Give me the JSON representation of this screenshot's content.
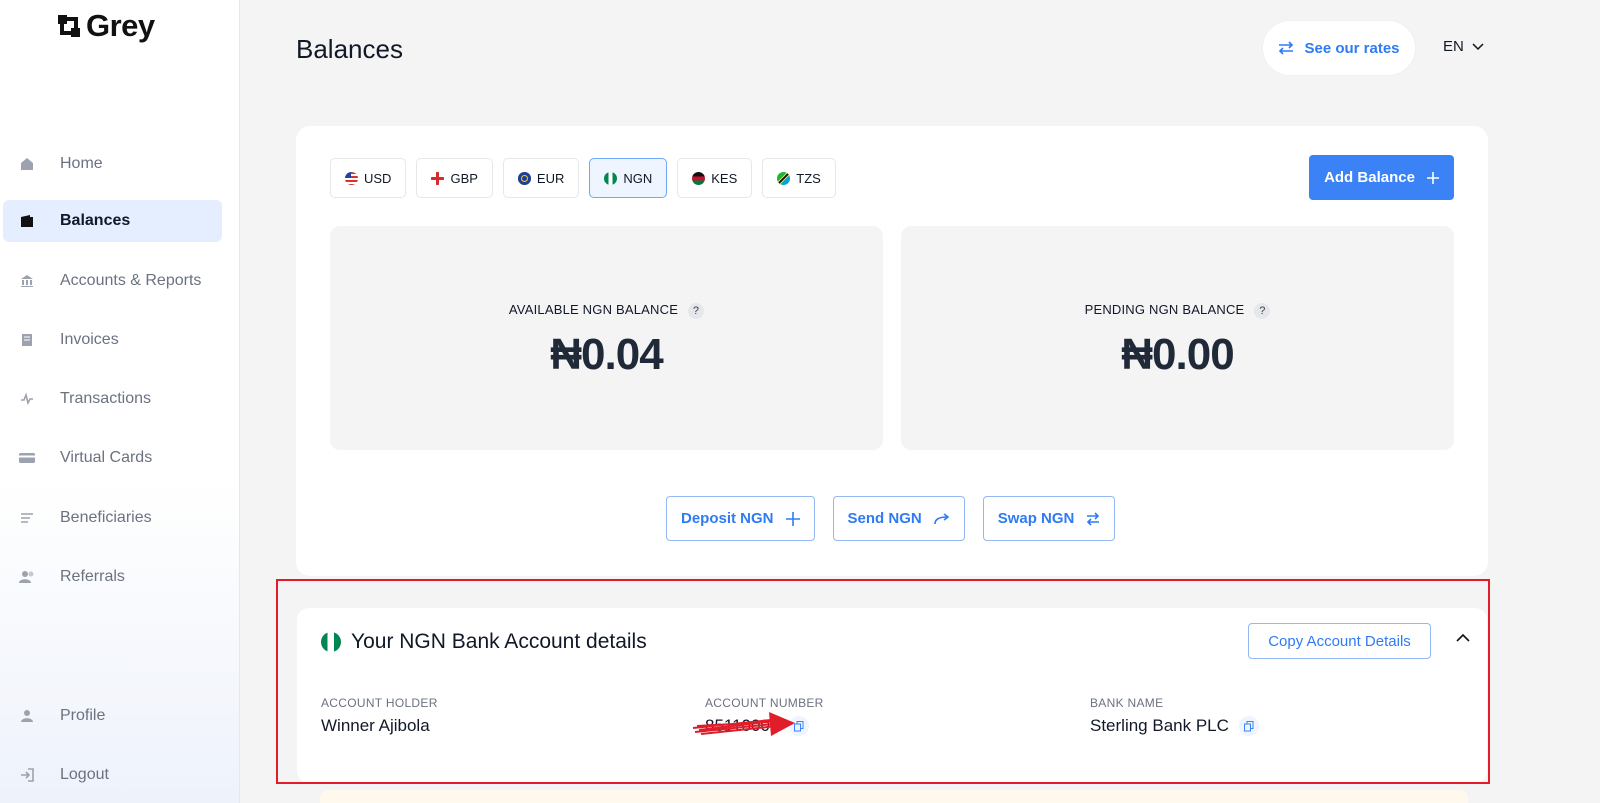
{
  "app": {
    "name": "Grey"
  },
  "sidebar": {
    "items": [
      {
        "label": "Home",
        "icon": "home-icon"
      },
      {
        "label": "Balances",
        "icon": "wallet-icon",
        "active": true
      },
      {
        "label": "Accounts & Reports",
        "icon": "bank-icon"
      },
      {
        "label": "Invoices",
        "icon": "invoice-icon"
      },
      {
        "label": "Transactions",
        "icon": "activity-icon"
      },
      {
        "label": "Virtual Cards",
        "icon": "card-icon"
      },
      {
        "label": "Beneficiaries",
        "icon": "list-icon"
      },
      {
        "label": "Referrals",
        "icon": "users-icon"
      }
    ],
    "bottom": [
      {
        "label": "Profile",
        "icon": "user-icon"
      },
      {
        "label": "Logout",
        "icon": "logout-icon"
      }
    ]
  },
  "header": {
    "title": "Balances",
    "rates_label": "See our rates",
    "language": "EN"
  },
  "currency_tabs": [
    {
      "code": "USD"
    },
    {
      "code": "GBP"
    },
    {
      "code": "EUR"
    },
    {
      "code": "NGN",
      "active": true
    },
    {
      "code": "KES"
    },
    {
      "code": "TZS"
    }
  ],
  "add_balance_label": "Add Balance",
  "balances": {
    "available_label": "AVAILABLE NGN BALANCE",
    "available_value": "₦0.04",
    "pending_label": "PENDING NGN BALANCE",
    "pending_value": "₦0.00",
    "help": "?"
  },
  "actions": {
    "deposit": "Deposit NGN",
    "send": "Send NGN",
    "swap": "Swap NGN"
  },
  "bank_details": {
    "title": "Your NGN Bank Account details",
    "copy_label": "Copy Account Details",
    "holder_label": "ACCOUNT HOLDER",
    "holder_value": "Winner Ajibola",
    "number_label": "ACCOUNT NUMBER",
    "number_value": "85110000",
    "bank_label": "BANK NAME",
    "bank_value": "Sterling Bank PLC"
  },
  "colors": {
    "accent": "#3b82f6",
    "highlight": "#e11d2a",
    "nigeria_green": "#008751"
  }
}
